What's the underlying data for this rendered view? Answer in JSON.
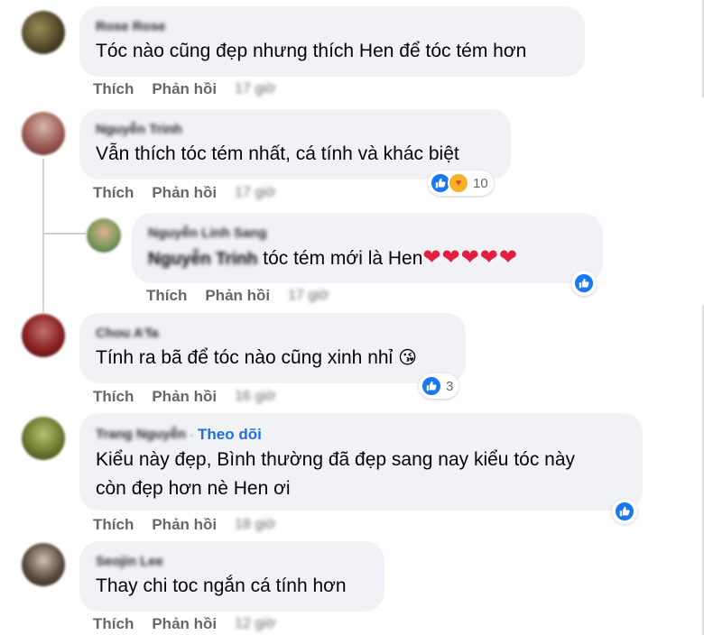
{
  "actions": {
    "like": "Thích",
    "reply": "Phản hồi"
  },
  "like_color": "#1877f2",
  "follow_color": "#216fdb",
  "comments": [
    {
      "name": "Rose Rose",
      "text": "Tóc nào cũng đẹp nhưng thích Hen để tóc tém hơn",
      "time": "17 giờ"
    },
    {
      "name": "Nguyễn Trinh",
      "text": "Vẫn thích tóc tém nhất, cá tính và khác biệt",
      "time": "17 giờ",
      "reaction_count": "10"
    },
    {
      "name": "Nguyễn Linh Sang",
      "mention": "Nguyễn Trinh",
      "text": " tóc tém mới là Hen",
      "hearts": "❤❤❤❤❤",
      "time": "17 giờ"
    },
    {
      "name": "Chou A'fa",
      "text": "Tính ra bã để tóc nào cũng xinh nhỉ",
      "emoji": "😘",
      "time": "16 giờ",
      "reaction_count": "3"
    },
    {
      "name": "Trang Nguyễn",
      "follow": "Theo dõi",
      "text": "Kiểu này đẹp, Bình thường đã đẹp sang nay kiểu tóc này\ncòn đẹp hơn nè Hen ơi",
      "time": "18 giờ"
    },
    {
      "name": "Seojin Lee",
      "text": "Thay chi toc ngắn cá tính hơn",
      "time": "12 giờ"
    }
  ]
}
